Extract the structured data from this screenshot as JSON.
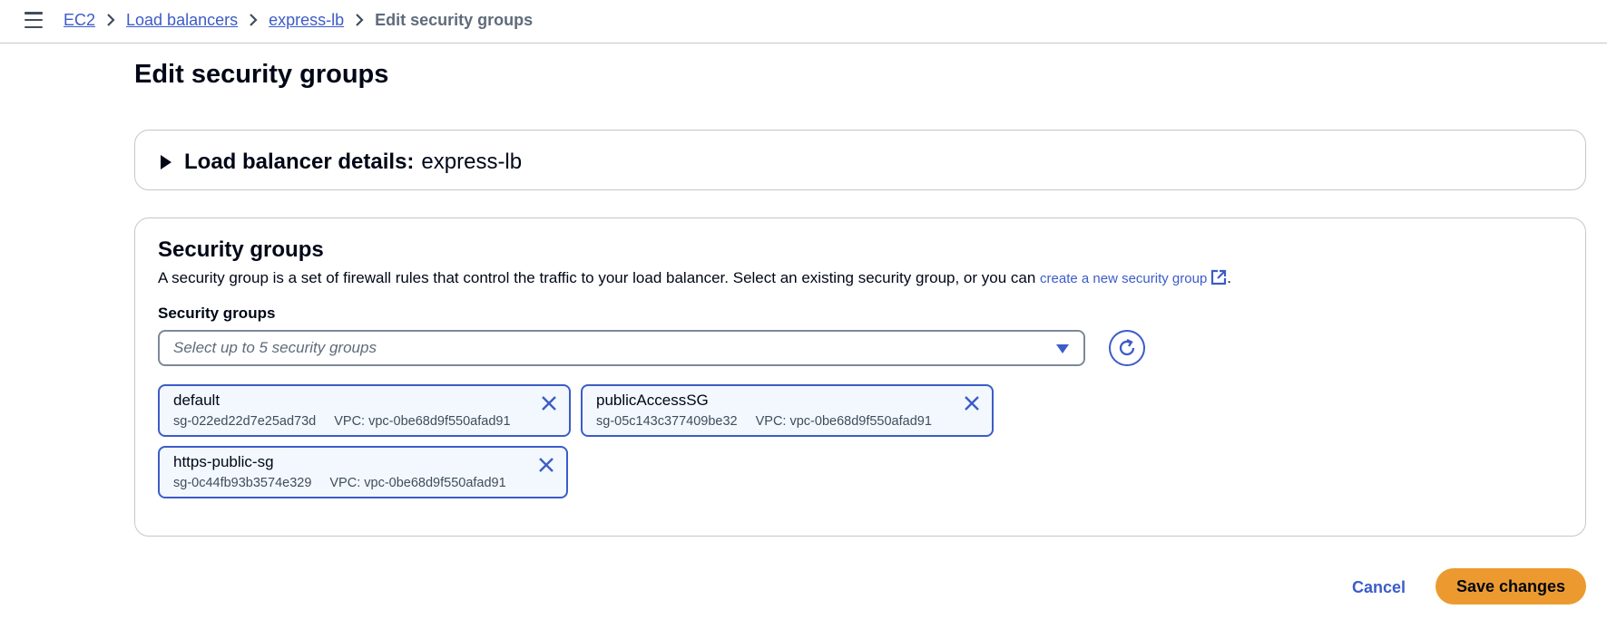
{
  "breadcrumb": {
    "items": [
      "EC2",
      "Load balancers",
      "express-lb"
    ],
    "current": "Edit security groups"
  },
  "page": {
    "title": "Edit security groups"
  },
  "details": {
    "label": "Load balancer details:",
    "value": "express-lb"
  },
  "security_groups": {
    "title": "Security groups",
    "description": "A security group is a set of firewall rules that control the traffic to your load balancer. Select an existing security group, or you can ",
    "link_text": "create a new security group",
    "description_end": ".",
    "field_label": "Security groups",
    "placeholder": "Select up to 5 security groups",
    "selected": [
      {
        "name": "default",
        "id": "sg-022ed22d7e25ad73d",
        "vpc": "VPC: vpc-0be68d9f550afad91"
      },
      {
        "name": "publicAccessSG",
        "id": "sg-05c143c377409be32",
        "vpc": "VPC: vpc-0be68d9f550afad91"
      },
      {
        "name": "https-public-sg",
        "id": "sg-0c44fb93b3574e329",
        "vpc": "VPC: vpc-0be68d9f550afad91"
      }
    ]
  },
  "actions": {
    "cancel": "Cancel",
    "save": "Save changes"
  },
  "colors": {
    "accent": "#3c5cc8",
    "primary_button": "#ec9a2f",
    "token_bg": "#f2f8fd"
  },
  "icons": [
    "menu-icon",
    "chevron-right-icon",
    "caret-right-icon",
    "external-link-icon",
    "caret-down-icon",
    "refresh-icon",
    "close-icon"
  ]
}
